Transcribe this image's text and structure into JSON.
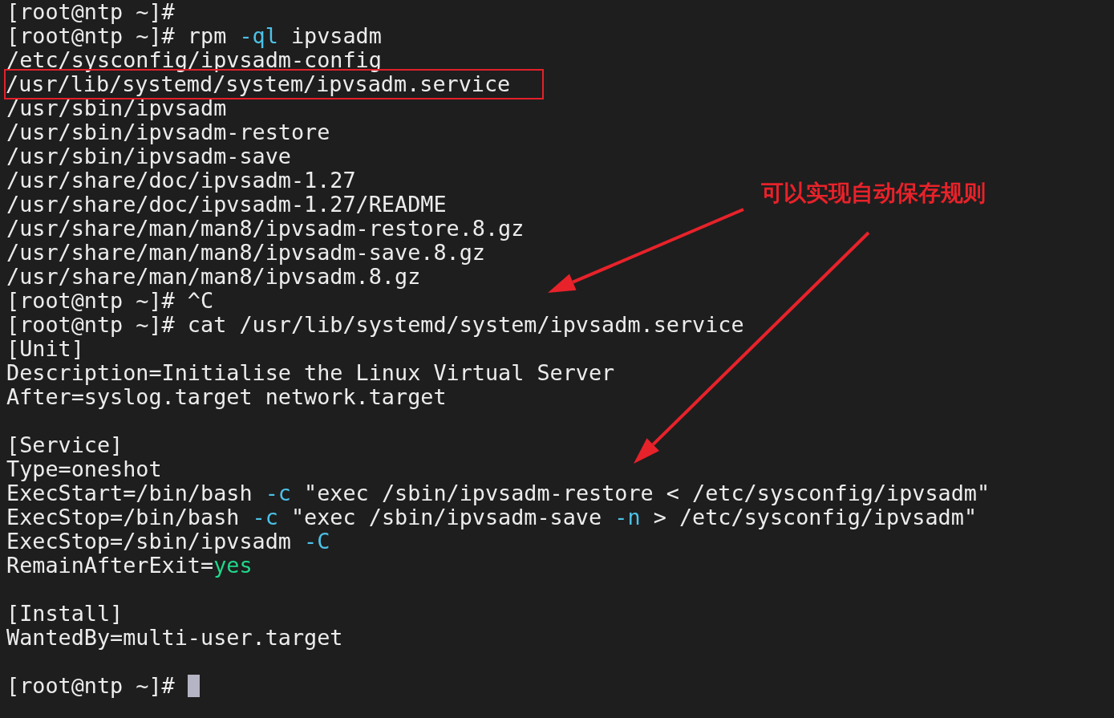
{
  "terminal": {
    "lines": [
      {
        "kind": "text",
        "boxed": false,
        "segments": [
          {
            "kind": "plain",
            "text": "[root@ntp ~]#"
          }
        ]
      },
      {
        "kind": "text",
        "boxed": false,
        "segments": [
          {
            "kind": "plain",
            "text": "[root@ntp ~]# rpm "
          },
          {
            "kind": "option",
            "text": "-ql"
          },
          {
            "kind": "plain",
            "text": " ipvsadm"
          }
        ]
      },
      {
        "kind": "text",
        "boxed": false,
        "segments": [
          {
            "kind": "plain",
            "text": "/etc/sysconfig/ipvsadm-config"
          }
        ]
      },
      {
        "kind": "text",
        "boxed": true,
        "segments": [
          {
            "kind": "plain",
            "text": "/usr/lib/systemd/system/ipvsadm.service"
          }
        ]
      },
      {
        "kind": "text",
        "boxed": false,
        "segments": [
          {
            "kind": "plain",
            "text": "/usr/sbin/ipvsadm"
          }
        ]
      },
      {
        "kind": "text",
        "boxed": false,
        "segments": [
          {
            "kind": "plain",
            "text": "/usr/sbin/ipvsadm-restore"
          }
        ]
      },
      {
        "kind": "text",
        "boxed": false,
        "segments": [
          {
            "kind": "plain",
            "text": "/usr/sbin/ipvsadm-save"
          }
        ]
      },
      {
        "kind": "text",
        "boxed": false,
        "segments": [
          {
            "kind": "plain",
            "text": "/usr/share/doc/ipvsadm-1.27"
          }
        ]
      },
      {
        "kind": "text",
        "boxed": false,
        "segments": [
          {
            "kind": "plain",
            "text": "/usr/share/doc/ipvsadm-1.27/README"
          }
        ]
      },
      {
        "kind": "text",
        "boxed": false,
        "segments": [
          {
            "kind": "plain",
            "text": "/usr/share/man/man8/ipvsadm-restore.8.gz"
          }
        ]
      },
      {
        "kind": "text",
        "boxed": false,
        "segments": [
          {
            "kind": "plain",
            "text": "/usr/share/man/man8/ipvsadm-save.8.gz"
          }
        ]
      },
      {
        "kind": "text",
        "boxed": false,
        "segments": [
          {
            "kind": "plain",
            "text": "/usr/share/man/man8/ipvsadm.8.gz"
          }
        ]
      },
      {
        "kind": "text",
        "boxed": false,
        "segments": [
          {
            "kind": "plain",
            "text": "[root@ntp ~]# ^C"
          }
        ]
      },
      {
        "kind": "text",
        "boxed": false,
        "segments": [
          {
            "kind": "plain",
            "text": "[root@ntp ~]# cat /usr/lib/systemd/system/ipvsadm.service"
          }
        ]
      },
      {
        "kind": "text",
        "boxed": false,
        "segments": [
          {
            "kind": "plain",
            "text": "[Unit]"
          }
        ]
      },
      {
        "kind": "text",
        "boxed": false,
        "segments": [
          {
            "kind": "plain",
            "text": "Description=Initialise the Linux Virtual Server"
          }
        ]
      },
      {
        "kind": "text",
        "boxed": false,
        "segments": [
          {
            "kind": "plain",
            "text": "After=syslog.target network.target"
          }
        ]
      },
      {
        "kind": "blank"
      },
      {
        "kind": "text",
        "boxed": false,
        "segments": [
          {
            "kind": "plain",
            "text": "[Service]"
          }
        ]
      },
      {
        "kind": "text",
        "boxed": false,
        "segments": [
          {
            "kind": "plain",
            "text": "Type=oneshot"
          }
        ]
      },
      {
        "kind": "text",
        "boxed": false,
        "segments": [
          {
            "kind": "plain",
            "text": "ExecStart=/bin/bash "
          },
          {
            "kind": "option",
            "text": "-c"
          },
          {
            "kind": "plain",
            "text": " \"exec /sbin/ipvsadm-restore < /etc/sysconfig/ipvsadm\""
          }
        ]
      },
      {
        "kind": "text",
        "boxed": false,
        "segments": [
          {
            "kind": "plain",
            "text": "ExecStop=/bin/bash "
          },
          {
            "kind": "option",
            "text": "-c"
          },
          {
            "kind": "plain",
            "text": " \"exec /sbin/ipvsadm-save "
          },
          {
            "kind": "option",
            "text": "-n"
          },
          {
            "kind": "plain",
            "text": " > /etc/sysconfig/ipvsadm\""
          }
        ]
      },
      {
        "kind": "text",
        "boxed": false,
        "segments": [
          {
            "kind": "plain",
            "text": "ExecStop=/sbin/ipvsadm "
          },
          {
            "kind": "option",
            "text": "-C"
          }
        ]
      },
      {
        "kind": "text",
        "boxed": false,
        "segments": [
          {
            "kind": "plain",
            "text": "RemainAfterExit="
          },
          {
            "kind": "value",
            "text": "yes"
          }
        ]
      },
      {
        "kind": "blank"
      },
      {
        "kind": "text",
        "boxed": false,
        "segments": [
          {
            "kind": "plain",
            "text": "[Install]"
          }
        ]
      },
      {
        "kind": "text",
        "boxed": false,
        "segments": [
          {
            "kind": "plain",
            "text": "WantedBy=multi-user.target"
          }
        ]
      },
      {
        "kind": "blank"
      },
      {
        "kind": "prompt",
        "boxed": false,
        "segments": [
          {
            "kind": "plain",
            "text": "[root@ntp ~]#"
          }
        ]
      }
    ]
  },
  "annotation": {
    "text": "可以实现自动保存规则"
  }
}
